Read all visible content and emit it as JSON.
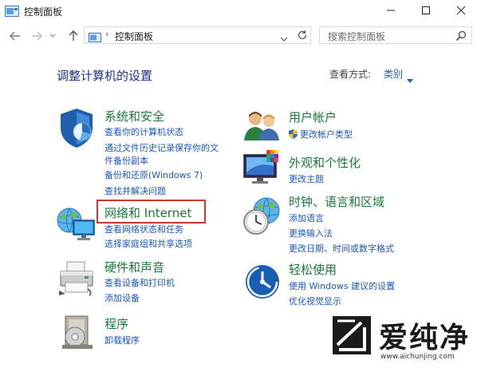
{
  "window": {
    "title": "控制面板"
  },
  "address_bar": {
    "path": "控制面板",
    "separator": "›"
  },
  "search": {
    "placeholder": "搜索控制面板"
  },
  "header": {
    "heading": "调整计算机的设置",
    "view_by_label": "查看方式:",
    "view_by_value": "类别"
  },
  "categories_left": [
    {
      "title": "系统和安全",
      "links": [
        "查看你的计算机状态",
        "通过文件历史记录保存你的文",
        "件备份副本",
        "备份和还原(Windows 7)",
        "查找并解决问题"
      ]
    },
    {
      "title": "网络和 Internet",
      "links": [
        "查看网络状态和任务",
        "选择家庭组和共享选项"
      ]
    },
    {
      "title": "硬件和声音",
      "links": [
        "查看设备和打印机",
        "添加设备"
      ]
    },
    {
      "title": "程序",
      "links": [
        "卸载程序"
      ]
    }
  ],
  "categories_right": [
    {
      "title": "用户帐户",
      "links": [
        "更改帐户类型"
      ]
    },
    {
      "title": "外观和个性化",
      "links": [
        "更改主题"
      ]
    },
    {
      "title": "时钟、语言和区域",
      "links": [
        "添加语言",
        "更换输入法",
        "更改日期、时间或数字格式"
      ]
    },
    {
      "title": "轻松使用",
      "links": [
        "使用 Windows 建议的设置",
        "优化视觉显示"
      ]
    }
  ],
  "watermark": {
    "brand": "爱纯净",
    "url": "www.aichunjing.com"
  },
  "colors": {
    "category_title": "#187a3a",
    "link": "#1b56c0",
    "heading": "#1e3287",
    "highlight": "#d3352c"
  }
}
